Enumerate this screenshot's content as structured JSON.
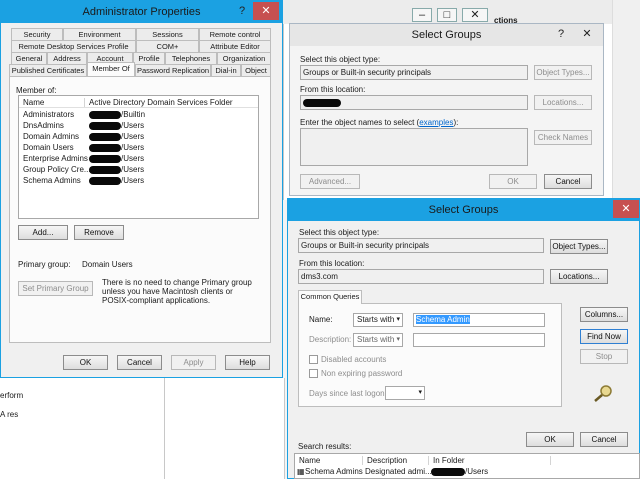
{
  "bg": {
    "tab_label": "ctions",
    "left_fragments": [
      "erform",
      "A res"
    ]
  },
  "admin_props": {
    "title": "Administrator Properties",
    "help_label": "?",
    "close_label": "✕",
    "tabs_row1": [
      "Security",
      "Environment",
      "Sessions",
      "Remote control"
    ],
    "tabs_row2": [
      "Remote Desktop Services Profile",
      "COM+",
      "Attribute Editor"
    ],
    "tabs_row3": [
      "General",
      "Address",
      "Account",
      "Profile",
      "Telephones",
      "Organization"
    ],
    "tabs_row4": [
      "Published Certificates",
      "Member Of",
      "Password Replication",
      "Dial-in",
      "Object"
    ],
    "member_of_label": "Member of:",
    "col_name": "Name",
    "col_folder": "Active Directory Domain Services Folder",
    "members": [
      {
        "name": "Administrators",
        "folder": "/Builtin"
      },
      {
        "name": "DnsAdmins",
        "folder": "/Users"
      },
      {
        "name": "Domain Admins",
        "folder": "/Users"
      },
      {
        "name": "Domain Users",
        "folder": "/Users"
      },
      {
        "name": "Enterprise Admins",
        "folder": "/Users"
      },
      {
        "name": "Group Policy Cre...",
        "folder": "/Users"
      },
      {
        "name": "Schema Admins",
        "folder": "/Users"
      }
    ],
    "add_label": "Add...",
    "remove_label": "Remove",
    "primary_group_label": "Primary group:",
    "primary_group_value": "Domain Users",
    "set_primary_label": "Set Primary Group",
    "note": "There is no need to change Primary group unless you have Macintosh clients or POSIX-compliant applications.",
    "ok_label": "OK",
    "cancel_label": "Cancel",
    "apply_label": "Apply",
    "help_btn_label": "Help"
  },
  "select_groups_back": {
    "title": "Select Groups",
    "help_label": "?",
    "close_label": "✕",
    "object_type_label": "Select this object type:",
    "object_type_value": "Groups or Built-in security principals",
    "object_types_btn": "Object Types...",
    "location_label": "From this location:",
    "locations_btn": "Locations...",
    "enter_names_label": "Enter the object names to select",
    "examples_link": "examples",
    "check_names_btn": "Check Names",
    "advanced_btn": "Advanced...",
    "ok_label": "OK",
    "cancel_label": "Cancel"
  },
  "bg_window_controls": {
    "minimize": "–",
    "maximize": "□",
    "close": "✕"
  },
  "select_groups_front": {
    "title": "Select Groups",
    "close_label": "✕",
    "object_type_label": "Select this object type:",
    "object_type_value": "Groups or Built-in security principals",
    "object_types_btn": "Object Types...",
    "location_label": "From this location:",
    "location_value": "dms3.com",
    "locations_btn": "Locations...",
    "tab_common_queries": "Common Queries",
    "name_label": "Name:",
    "name_mode": "Starts with",
    "name_value": "Schema Admin",
    "description_label": "Description:",
    "description_mode": "Starts with",
    "disabled_accounts_label": "Disabled accounts",
    "non_expiring_label": "Non expiring password",
    "days_since_label": "Days since last logon:",
    "columns_btn": "Columns...",
    "find_now_btn": "Find Now",
    "stop_btn": "Stop",
    "ok_label": "OK",
    "cancel_label": "Cancel",
    "search_results_label": "Search results:",
    "results_cols": [
      "Name",
      "Description",
      "In Folder"
    ],
    "results": [
      {
        "name": "Schema Admins",
        "description": "Designated admi...",
        "folder": "/Users"
      }
    ]
  },
  "colors": {
    "accent": "#1ba1e2",
    "close_red": "#c75050",
    "selection": "#3399ff"
  }
}
